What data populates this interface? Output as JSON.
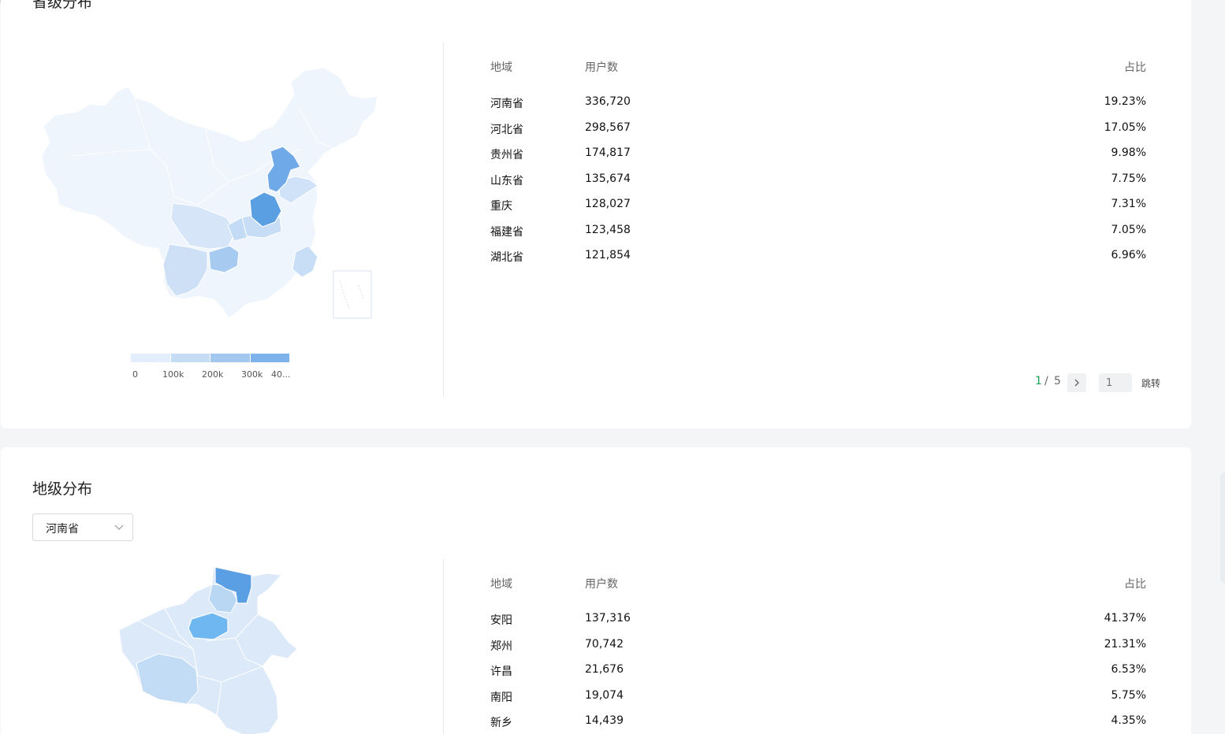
{
  "colors": {
    "scale": [
      "#e2eefb",
      "#c5dcf5",
      "#a2c8f0",
      "#7db3ea",
      "#5a9fe3"
    ],
    "accent": "#1aa35a"
  },
  "province_section": {
    "title": "省级分布",
    "table": {
      "headers": {
        "region": "地域",
        "users": "用户数",
        "share": "占比"
      },
      "rows": [
        {
          "region": "河南省",
          "users": "336,720",
          "share": "19.23%"
        },
        {
          "region": "河北省",
          "users": "298,567",
          "share": "17.05%"
        },
        {
          "region": "贵州省",
          "users": "174,817",
          "share": "9.98%"
        },
        {
          "region": "山东省",
          "users": "135,674",
          "share": "7.75%"
        },
        {
          "region": "重庆",
          "users": "128,027",
          "share": "7.31%"
        },
        {
          "region": "福建省",
          "users": "123,458",
          "share": "7.05%"
        },
        {
          "region": "湖北省",
          "users": "121,854",
          "share": "6.96%"
        }
      ]
    },
    "legend": {
      "ticks": [
        "0",
        "100k",
        "200k",
        "300k",
        "40..."
      ]
    },
    "pager": {
      "current": "1",
      "separator": "/",
      "total": "5",
      "jump_placeholder": "1",
      "jump_label": "跳转"
    }
  },
  "city_section": {
    "title": "地级分布",
    "select": {
      "value": "河南省"
    },
    "table": {
      "headers": {
        "region": "地域",
        "users": "用户数",
        "share": "占比"
      },
      "rows": [
        {
          "region": "安阳",
          "users": "137,316",
          "share": "41.37%"
        },
        {
          "region": "郑州",
          "users": "70,742",
          "share": "21.31%"
        },
        {
          "region": "许昌",
          "users": "21,676",
          "share": "6.53%"
        },
        {
          "region": "南阳",
          "users": "19,074",
          "share": "5.75%"
        },
        {
          "region": "新乡",
          "users": "14,439",
          "share": "4.35%"
        }
      ]
    }
  }
}
